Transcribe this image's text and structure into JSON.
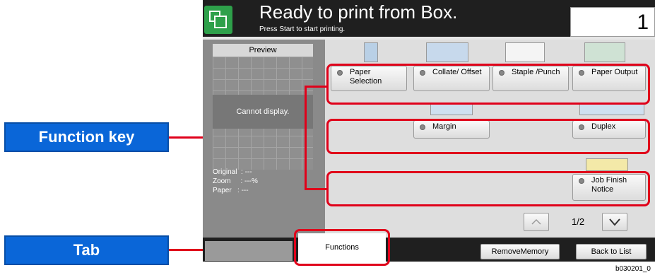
{
  "header": {
    "title": "Ready to print from Box.",
    "subtitle": "Press Start to start printing.",
    "copies_value": "1"
  },
  "preview": {
    "label": "Preview",
    "message": "Cannot display.",
    "original_label": "Original",
    "original_value": ": ---",
    "zoom_label": "Zoom",
    "zoom_value": ": ---%",
    "paper_label": "Paper",
    "paper_value": ": ---"
  },
  "functions": {
    "row1": [
      "Paper Selection",
      "Collate/ Offset",
      "Staple /Punch",
      "Paper Output"
    ],
    "margin": "Margin",
    "duplex": "Duplex",
    "job_finish": "Job Finish Notice"
  },
  "pager": {
    "page": "1/2"
  },
  "tabs": {
    "active": "Functions"
  },
  "buttons": {
    "remove_memory": "RemoveMemory",
    "back_to_list": "Back to List"
  },
  "callouts": {
    "function_key": "Function key",
    "tab": "Tab"
  },
  "figure_code": "b030201_0",
  "colors": {
    "callout": "#0a66d8",
    "highlight": "#e0001a",
    "header": "#1f1f1f"
  }
}
